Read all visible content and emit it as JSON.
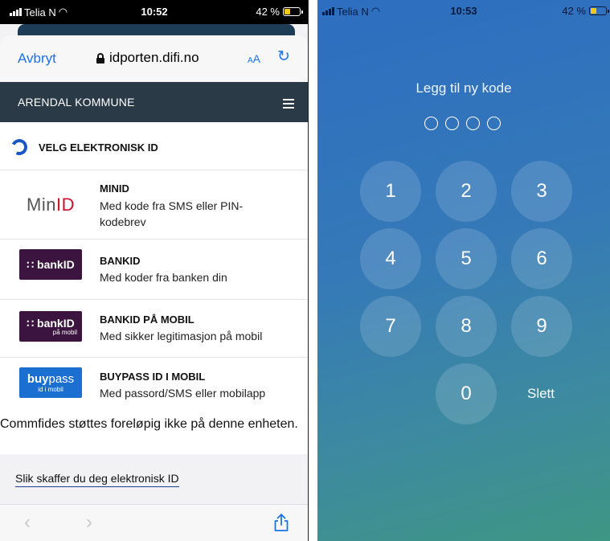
{
  "left_phone": {
    "status": {
      "carrier": "Telia N",
      "time": "10:52",
      "battery": "42 %"
    },
    "browser": {
      "cancel": "Avbryt",
      "url": "idporten.difi.no",
      "text_size": "AA",
      "reload_icon": "reload-icon"
    },
    "nav": {
      "title": "ARENDAL KOMMUNE",
      "menu_icon": "hamburger-icon"
    },
    "picker_title": "VELG ELEKTRONISK ID",
    "options": [
      {
        "logo": "MinID",
        "title": "MINID",
        "desc": "Med kode fra SMS eller PIN-kodebrev"
      },
      {
        "logo": "bankID",
        "title": "BANKID",
        "desc": "Med koder fra banken din"
      },
      {
        "logo": "bankID",
        "logo_sub": "på mobil",
        "title": "BANKID PÅ MOBIL",
        "desc": "Med sikker legitimasjon på mobil"
      },
      {
        "logo": "buypass",
        "logo_sub": "id i mobil",
        "title": "BUYPASS ID I MOBIL",
        "desc": "Med passord/SMS eller mobilapp"
      }
    ],
    "note": "Commfides støttes foreløpig ikke på denne enheten.",
    "howto_link": "Slik skaffer du deg elektronisk ID"
  },
  "right_phone": {
    "status": {
      "carrier": "Telia N",
      "time": "10:53",
      "battery": "42 %"
    },
    "title": "Legg til ny kode",
    "pin_length": 4,
    "keys": [
      "1",
      "2",
      "3",
      "4",
      "5",
      "6",
      "7",
      "8",
      "9",
      "0"
    ],
    "delete_label": "Slett"
  },
  "colors": {
    "nav_bg": "#2b3a47",
    "accent_blue": "#1a73e8",
    "bankid_purple": "#3b1540",
    "buypass_blue": "#1a6fd1"
  }
}
